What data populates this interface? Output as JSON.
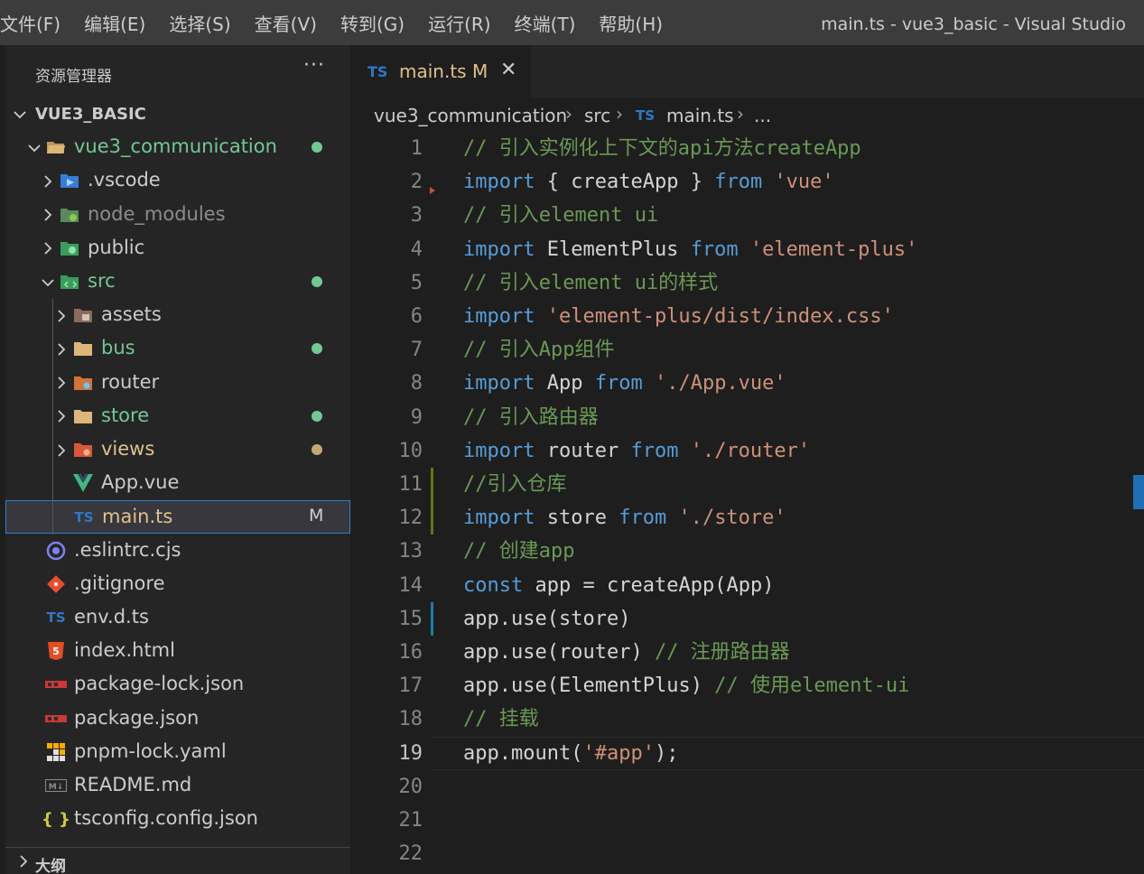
{
  "menu": [
    "文件(F)",
    "编辑(E)",
    "选择(S)",
    "查看(V)",
    "转到(G)",
    "运行(R)",
    "终端(T)",
    "帮助(H)"
  ],
  "window_title": "main.ts - vue3_basic - Visual Studio",
  "explorer": {
    "title": "资源管理器",
    "more": "···",
    "root": "VUE3_BASIC",
    "outline": "大纲",
    "items": [
      {
        "label": "vue3_communication",
        "icon": "folder-open-icon",
        "color": "#73c991",
        "dot": "#73c991",
        "mflag": ""
      },
      {
        "label": ".vscode",
        "icon": "vscode-folder-icon",
        "color": "#cccccc",
        "dot": "",
        "mflag": ""
      },
      {
        "label": "node_modules",
        "icon": "node-folder-icon",
        "color": "#8c8c8c",
        "dot": "",
        "mflag": ""
      },
      {
        "label": "public",
        "icon": "public-folder-icon",
        "color": "#cccccc",
        "dot": "",
        "mflag": ""
      },
      {
        "label": "src",
        "icon": "src-folder-icon",
        "color": "#73c991",
        "dot": "#73c991",
        "mflag": ""
      },
      {
        "label": "assets",
        "icon": "assets-folder-icon",
        "color": "#cccccc",
        "dot": "",
        "mflag": ""
      },
      {
        "label": "bus",
        "icon": "folder-icon",
        "color": "#73c991",
        "dot": "#73c991",
        "mflag": ""
      },
      {
        "label": "router",
        "icon": "router-folder-icon",
        "color": "#cccccc",
        "dot": "",
        "mflag": ""
      },
      {
        "label": "store",
        "icon": "folder-icon",
        "color": "#73c991",
        "dot": "#73c991",
        "mflag": ""
      },
      {
        "label": "views",
        "icon": "views-folder-icon",
        "color": "#e2c08d",
        "dot": "#c5a773",
        "mflag": ""
      },
      {
        "label": "App.vue",
        "icon": "vue-icon",
        "color": "#cccccc",
        "dot": "",
        "mflag": ""
      },
      {
        "label": "main.ts",
        "icon": "typescript-icon",
        "color": "#e2c08d",
        "dot": "",
        "mflag": "M"
      },
      {
        "label": ".eslintrc.cjs",
        "icon": "eslint-icon",
        "color": "#cccccc",
        "dot": "",
        "mflag": ""
      },
      {
        "label": ".gitignore",
        "icon": "git-icon",
        "color": "#cccccc",
        "dot": "",
        "mflag": ""
      },
      {
        "label": "env.d.ts",
        "icon": "typescript-icon",
        "color": "#cccccc",
        "dot": "",
        "mflag": ""
      },
      {
        "label": "index.html",
        "icon": "html-icon",
        "color": "#cccccc",
        "dot": "",
        "mflag": ""
      },
      {
        "label": "package-lock.json",
        "icon": "npm-icon",
        "color": "#cccccc",
        "dot": "",
        "mflag": ""
      },
      {
        "label": "package.json",
        "icon": "npm-icon",
        "color": "#cccccc",
        "dot": "",
        "mflag": ""
      },
      {
        "label": "pnpm-lock.yaml",
        "icon": "pnpm-icon",
        "color": "#cccccc",
        "dot": "",
        "mflag": ""
      },
      {
        "label": "README.md",
        "icon": "markdown-icon",
        "color": "#cccccc",
        "dot": "",
        "mflag": ""
      },
      {
        "label": "tsconfig.config.json",
        "icon": "json-icon",
        "color": "#cccccc",
        "dot": "",
        "mflag": ""
      }
    ]
  },
  "tab": {
    "label": "main.ts",
    "badge": "TS",
    "modified": "M",
    "close": "✕"
  },
  "breadcrumb": [
    "vue3_communication",
    "src",
    "main.ts",
    "..."
  ],
  "breadcrumb_file_badge": "TS",
  "code_lines": [
    [
      [
        "comment",
        "// 引入实例化上下文的api方法createApp"
      ]
    ],
    [
      [
        "keyword",
        "import"
      ],
      [
        "punct",
        " { "
      ],
      [
        "ident",
        "createApp"
      ],
      [
        "punct",
        " } "
      ],
      [
        "keyword",
        "from"
      ],
      [
        "punct",
        " "
      ],
      [
        "string",
        "'vue'"
      ]
    ],
    [
      [
        "comment",
        "// 引入element ui"
      ]
    ],
    [
      [
        "keyword",
        "import"
      ],
      [
        "punct",
        " "
      ],
      [
        "ident",
        "ElementPlus"
      ],
      [
        "punct",
        " "
      ],
      [
        "keyword",
        "from"
      ],
      [
        "punct",
        " "
      ],
      [
        "string",
        "'element-plus'"
      ]
    ],
    [
      [
        "comment",
        "// 引入element ui的样式"
      ]
    ],
    [
      [
        "keyword",
        "import"
      ],
      [
        "punct",
        " "
      ],
      [
        "string",
        "'element-plus/dist/index.css'"
      ]
    ],
    [
      [
        "comment",
        "// 引入App组件"
      ]
    ],
    [
      [
        "keyword",
        "import"
      ],
      [
        "punct",
        " "
      ],
      [
        "ident",
        "App"
      ],
      [
        "punct",
        " "
      ],
      [
        "keyword",
        "from"
      ],
      [
        "punct",
        " "
      ],
      [
        "string",
        "'./App.vue'"
      ]
    ],
    [
      [
        "comment",
        "// 引入路由器"
      ]
    ],
    [
      [
        "keyword",
        "import"
      ],
      [
        "punct",
        " "
      ],
      [
        "ident",
        "router"
      ],
      [
        "punct",
        " "
      ],
      [
        "keyword",
        "from"
      ],
      [
        "punct",
        " "
      ],
      [
        "string",
        "'./router'"
      ]
    ],
    [
      [
        "comment",
        "//引入仓库"
      ]
    ],
    [
      [
        "keyword",
        "import"
      ],
      [
        "punct",
        " "
      ],
      [
        "ident",
        "store"
      ],
      [
        "punct",
        " "
      ],
      [
        "keyword",
        "from"
      ],
      [
        "punct",
        " "
      ],
      [
        "string",
        "'./store'"
      ]
    ],
    [
      [
        "comment",
        "// 创建app"
      ]
    ],
    [
      [
        "keyword",
        "const"
      ],
      [
        "punct",
        " "
      ],
      [
        "ident",
        "app"
      ],
      [
        "punct",
        " = "
      ],
      [
        "ident",
        "createApp"
      ],
      [
        "punct",
        "("
      ],
      [
        "ident",
        "App"
      ],
      [
        "punct",
        ")"
      ]
    ],
    [
      [
        "ident",
        "app"
      ],
      [
        "punct",
        "."
      ],
      [
        "ident",
        "use"
      ],
      [
        "punct",
        "("
      ],
      [
        "ident",
        "store"
      ],
      [
        "punct",
        ")"
      ]
    ],
    [
      [
        "ident",
        "app"
      ],
      [
        "punct",
        "."
      ],
      [
        "ident",
        "use"
      ],
      [
        "punct",
        "("
      ],
      [
        "ident",
        "router"
      ],
      [
        "punct",
        ") "
      ],
      [
        "comment",
        "// 注册路由器"
      ]
    ],
    [
      [
        "ident",
        "app"
      ],
      [
        "punct",
        "."
      ],
      [
        "ident",
        "use"
      ],
      [
        "punct",
        "("
      ],
      [
        "ident",
        "ElementPlus"
      ],
      [
        "punct",
        ") "
      ],
      [
        "comment",
        "// 使用element-ui"
      ]
    ],
    [
      [
        "comment",
        "// 挂载"
      ]
    ],
    [
      [
        "ident",
        "app"
      ],
      [
        "punct",
        "."
      ],
      [
        "ident",
        "mount"
      ],
      [
        "punct",
        "("
      ],
      [
        "string",
        "'#app'"
      ],
      [
        "punct",
        ");"
      ]
    ],
    [],
    [],
    []
  ],
  "active_line": 19,
  "colors": {
    "accent": "#2f7fd6",
    "modified": "#e2c08d",
    "untracked": "#73c991",
    "keyword": "#569cd6",
    "string": "#ce9178",
    "comment": "#6a9955"
  }
}
